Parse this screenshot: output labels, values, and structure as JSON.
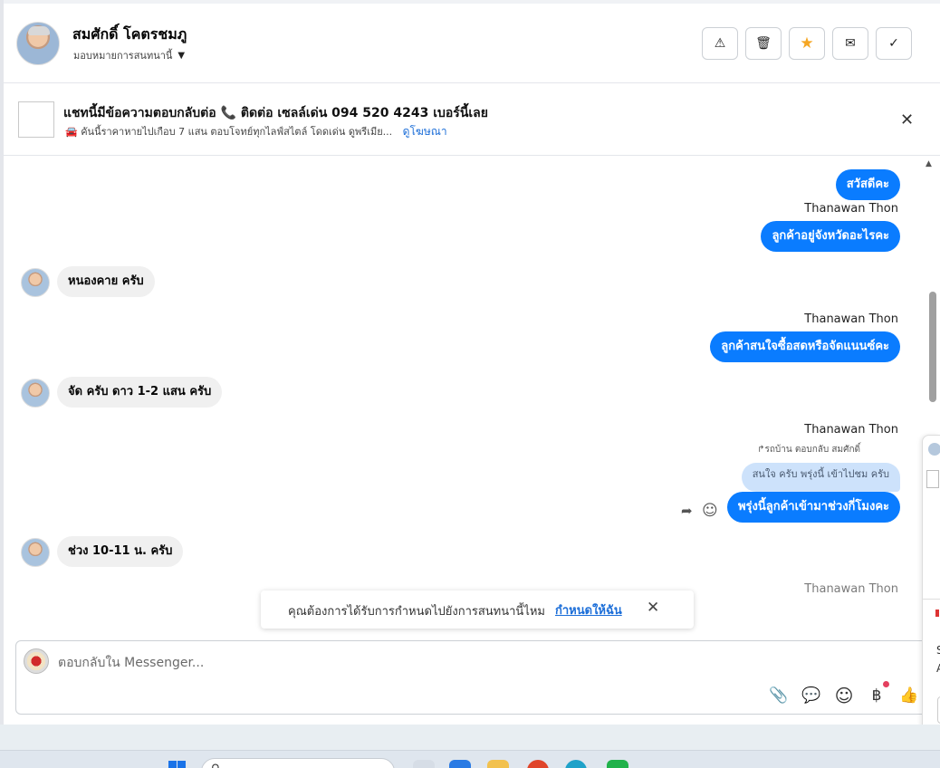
{
  "header": {
    "contact_name": "สมศักดิ์ โคตรชมภู",
    "assign_label": "มอบหมายการสนทนานี้",
    "actions": [
      {
        "name": "report-button",
        "icon": "warning-icon",
        "glyph": "⚠"
      },
      {
        "name": "delete-button",
        "icon": "trash-icon",
        "glyph": "🗑"
      },
      {
        "name": "star-button",
        "icon": "star-icon",
        "glyph": "★"
      },
      {
        "name": "mail-button",
        "icon": "mail-icon",
        "glyph": "✉"
      },
      {
        "name": "done-button",
        "icon": "check-icon",
        "glyph": "✓"
      }
    ]
  },
  "ad": {
    "title": "แชทนี้มีข้อความตอบกลับต่อ 📞 ติดต่อ เซลล์เด่น 094 520 4243 เบอร์นี้เลย",
    "subtitle": "🚘 คันนี้ราคาหายไปเกือบ 7 แสน ตอบโจทย์ทุกไลฟ์สไตล์ โดดเด่น ดูพรีเมีย...",
    "link": "ดูโฆษณา",
    "close_glyph": "✕"
  },
  "messages": {
    "m1": "สวัสดีคะ",
    "sender_name": "Thanawan Thon",
    "m2": "ลูกค้าอยู่จังหวัดอะไรคะ",
    "m3": "หนองคาย ครับ",
    "m4": "ลูกค้าสนใจซื้อสดหรือจัดแนนซ์คะ",
    "m5": "จัด ครับ ดาว 1-2  แสน ครับ",
    "reply_hint": "↱รถบ้าน ตอบกลับ สมศักดิ์",
    "quoted": "สนใจ ครับ พรุ่งนี้ เข้าไปชม ครับ",
    "m6": "พรุ่งนี้ลูกค้าเข้ามาช่วงกี่โมงคะ",
    "m7": "ช่วง 10-11 น. ครับ"
  },
  "toast": {
    "text": "คุณต้องการได้รับการกำหนดไปยังการสนทนานี้ไหม",
    "link": "กำหนดให้ฉัน",
    "close_glyph": "✕"
  },
  "composer": {
    "placeholder": "ตอบกลับใน Messenger...",
    "tools": [
      {
        "name": "attach-button",
        "icon": "paperclip-icon",
        "glyph": "📎"
      },
      {
        "name": "saved-replies-button",
        "icon": "chat-bubble-icon",
        "glyph": "💬"
      },
      {
        "name": "emoji-button",
        "icon": "smiley-icon",
        "glyph": "☺"
      },
      {
        "name": "payment-button",
        "icon": "baht-icon",
        "glyph": "฿"
      },
      {
        "name": "like-button",
        "icon": "thumbs-up-icon",
        "glyph": "👍"
      }
    ]
  },
  "peek": {
    "letter_s": "S",
    "letter_a": "A"
  },
  "colors": {
    "outgoing": "#0a7cff",
    "incoming": "#f0f0f0",
    "quoted": "#cde2fb",
    "link": "#1c6ed8",
    "star": "#f5a623"
  }
}
